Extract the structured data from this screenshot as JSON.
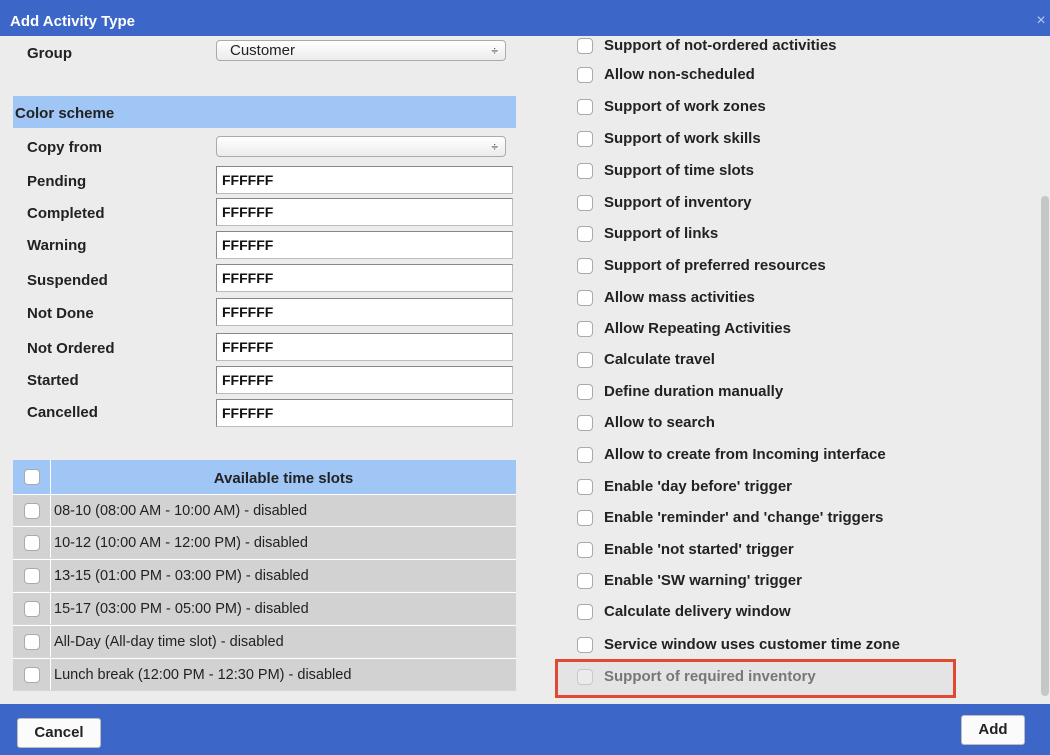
{
  "dialog": {
    "title": "Add Activity Type",
    "close_glyph": "×",
    "close_icon": "close-icon"
  },
  "group": {
    "label": "Group",
    "value": "Customer",
    "arrows": "÷"
  },
  "color_scheme": {
    "heading": "Color scheme",
    "copy_from": {
      "label": "Copy from",
      "value": "",
      "arrows": "÷"
    },
    "fields": [
      {
        "label": "Pending",
        "value": "FFFFFF"
      },
      {
        "label": "Completed",
        "value": "FFFFFF"
      },
      {
        "label": "Warning",
        "value": "FFFFFF"
      },
      {
        "label": "Suspended",
        "value": "FFFFFF"
      },
      {
        "label": "Not Done",
        "value": "FFFFFF"
      },
      {
        "label": "Not Ordered",
        "value": "FFFFFF"
      },
      {
        "label": "Started",
        "value": "FFFFFF"
      },
      {
        "label": "Cancelled",
        "value": "FFFFFF"
      }
    ]
  },
  "time_slots": {
    "heading": "Available time slots",
    "rows": [
      "08-10 (08:00 AM - 10:00 AM) - disabled",
      "10-12 (10:00 AM - 12:00 PM) - disabled",
      "13-15 (01:00 PM - 03:00 PM) - disabled",
      "15-17 (03:00 PM - 05:00 PM) - disabled",
      "All-Day (All-day time slot) - disabled",
      "Lunch break (12:00 PM - 12:30 PM) - disabled"
    ]
  },
  "options": [
    {
      "label": "Support of not-ordered activities",
      "disabled": false
    },
    {
      "label": "Allow non-scheduled",
      "disabled": false
    },
    {
      "label": "Support of work zones",
      "disabled": false
    },
    {
      "label": "Support of work skills",
      "disabled": false
    },
    {
      "label": "Support of time slots",
      "disabled": false
    },
    {
      "label": "Support of inventory",
      "disabled": false
    },
    {
      "label": "Support of links",
      "disabled": false
    },
    {
      "label": "Support of preferred resources",
      "disabled": false
    },
    {
      "label": "Allow mass activities",
      "disabled": false
    },
    {
      "label": "Allow Repeating Activities",
      "disabled": false
    },
    {
      "label": "Calculate travel",
      "disabled": false
    },
    {
      "label": "Define duration manually",
      "disabled": false
    },
    {
      "label": "Allow to search",
      "disabled": false
    },
    {
      "label": "Allow to create from Incoming interface",
      "disabled": false
    },
    {
      "label": "Enable 'day before' trigger",
      "disabled": false
    },
    {
      "label": "Enable 'reminder' and 'change' triggers",
      "disabled": false
    },
    {
      "label": "Enable 'not started' trigger",
      "disabled": false
    },
    {
      "label": "Enable 'SW warning' trigger",
      "disabled": false
    },
    {
      "label": "Calculate delivery window",
      "disabled": false
    },
    {
      "label": "Service window uses customer time zone",
      "disabled": false
    },
    {
      "label": "Support of required inventory",
      "disabled": true
    }
  ],
  "footer": {
    "cancel_label": "Cancel",
    "add_label": "Add"
  },
  "colors": {
    "title_bar": "#3c67c8",
    "section_header": "#9fc6f5",
    "highlight_border": "#e04a32"
  }
}
